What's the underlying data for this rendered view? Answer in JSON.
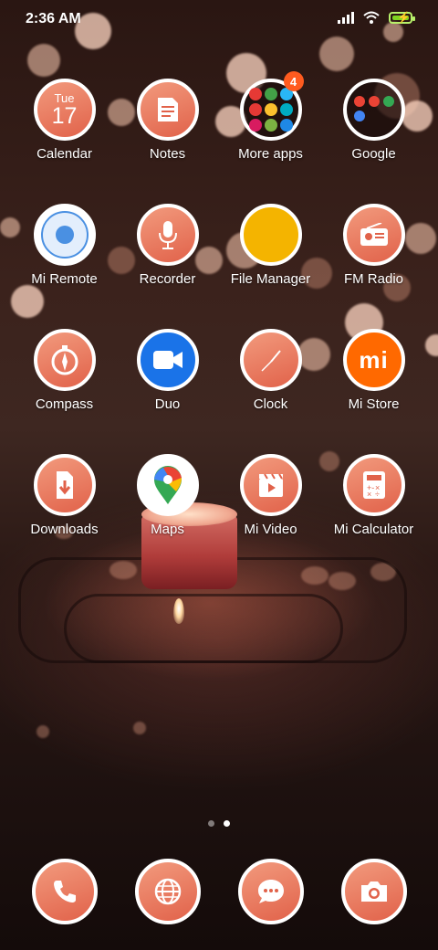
{
  "status_bar": {
    "time": "2:36 AM"
  },
  "apps": {
    "calendar": {
      "label": "Calendar",
      "day": "Tue",
      "date": "17"
    },
    "notes": {
      "label": "Notes"
    },
    "more_apps": {
      "label": "More apps",
      "badge": "4"
    },
    "google": {
      "label": "Google"
    },
    "mi_remote": {
      "label": "Mi Remote"
    },
    "recorder": {
      "label": "Recorder"
    },
    "file_manager": {
      "label": "File Manager"
    },
    "fm_radio": {
      "label": "FM Radio"
    },
    "compass": {
      "label": "Compass"
    },
    "duo": {
      "label": "Duo"
    },
    "clock": {
      "label": "Clock"
    },
    "mi_store": {
      "label": "Mi Store",
      "logo": "mi"
    },
    "downloads": {
      "label": "Downloads"
    },
    "maps": {
      "label": "Maps"
    },
    "mi_video": {
      "label": "Mi Video"
    },
    "mi_calculator": {
      "label": "Mi Calculator"
    }
  },
  "page_indicator": {
    "pages": 2,
    "current": 2
  },
  "dock": [
    "phone-icon",
    "browser-icon",
    "messages-icon",
    "camera-icon"
  ],
  "colors": {
    "icon_gradient_start": "#f29a7d",
    "icon_gradient_end": "#e1624a",
    "badge": "#ff5b1f",
    "mi_orange": "#ff6900",
    "duo_blue": "#1a73e8",
    "file_manager_yellow": "#f4b400"
  }
}
